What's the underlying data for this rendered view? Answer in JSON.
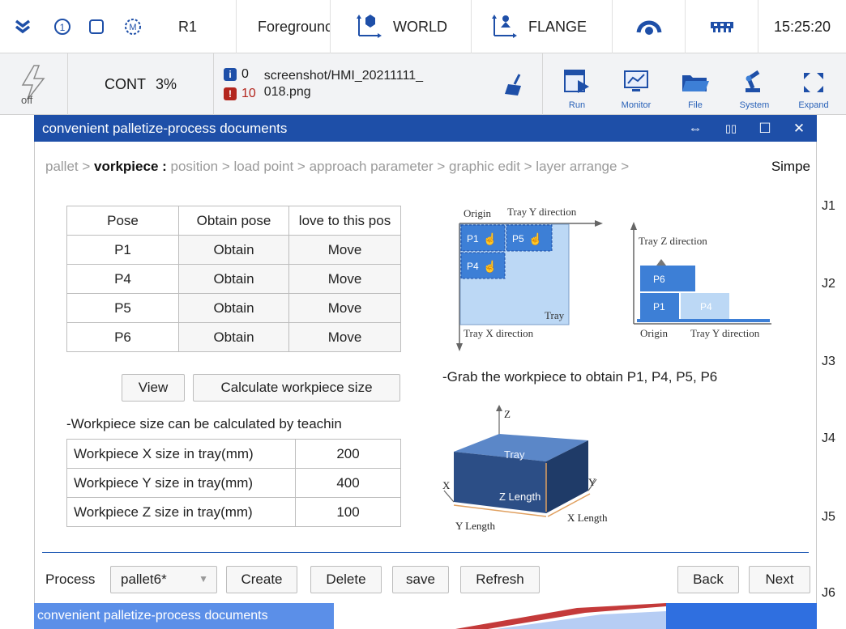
{
  "topbar": {
    "robot": "R1",
    "mode": "Foregrounc",
    "coord_world": "WORLD",
    "coord_tool": "FLANGE",
    "time": "15:25:20"
  },
  "statusbar": {
    "servo": "off",
    "run_mode": "CONT",
    "speed": "3%",
    "info_count": "0",
    "error_count": "10",
    "message_line1": "screenshot/HMI_20211111_",
    "message_line2": "018.png",
    "nav": [
      "Run",
      "Monitor",
      "File",
      "System",
      "Expand"
    ]
  },
  "dialog": {
    "title": "convenient palletize-process documents",
    "ctrl_icons": [
      "⇔",
      "▯▯",
      "☐",
      "✕"
    ]
  },
  "breadcrumb": {
    "before": "pallet > ",
    "current": "vorkpiece :",
    "after": " position > load point > approach parameter > graphic edit > layer arrange >",
    "last": "Simpe"
  },
  "pose_table": {
    "headers": [
      "Pose",
      "Obtain pose",
      "love to this pos"
    ],
    "rows": [
      {
        "pose": "P1",
        "obtain": "Obtain",
        "move": "Move"
      },
      {
        "pose": "P4",
        "obtain": "Obtain",
        "move": "Move"
      },
      {
        "pose": "P5",
        "obtain": "Obtain",
        "move": "Move"
      },
      {
        "pose": "P6",
        "obtain": "Obtain",
        "move": "Move"
      }
    ]
  },
  "buttons": {
    "view": "View",
    "calculate": "Calculate workpiece size"
  },
  "note_teach": "-Workpiece size can be calculated by teachin",
  "workpiece_size": [
    {
      "label": "Workpiece X size in tray(mm)",
      "value": "200"
    },
    {
      "label": "Workpiece Y size in tray(mm)",
      "value": "400"
    },
    {
      "label": "Workpiece Z size in tray(mm)",
      "value": "100"
    }
  ],
  "diagram_top": {
    "origin": "Origin",
    "tray_y": "Tray Y direction",
    "tray_x": "Tray X direction",
    "tray": "Tray",
    "p1": "P1",
    "p4": "P4",
    "p5": "P5",
    "tray_z": "Tray Z direction",
    "p6": "P6",
    "origin2": "Origin",
    "tray_y2": "Tray Y direction"
  },
  "grab_note": "-Grab the workpiece to obtain P1, P4, P5, P6",
  "diagram_3d": {
    "z": "Z",
    "tray": "Tray",
    "z_length": "Z Length",
    "x": "X",
    "y": "Y",
    "y_length": "Y Length",
    "x_length": "X Length"
  },
  "footer": {
    "process_label": "Process",
    "process_value": "pallet6*",
    "create": "Create",
    "delete": "Delete",
    "save": "save",
    "refresh": "Refresh",
    "back": "Back",
    "next": "Next"
  },
  "joints": [
    "J1",
    "J2",
    "J3",
    "J4",
    "J5",
    "J6"
  ],
  "taskbar": {
    "label": "convenient palletize-process documents"
  },
  "colors": {
    "title_bar": "#1e4fa8",
    "tray_fill": "#bcd8f5",
    "piece_fill": "#3d7fd6",
    "accent": "#2a62b8",
    "error": "#b3261e"
  }
}
